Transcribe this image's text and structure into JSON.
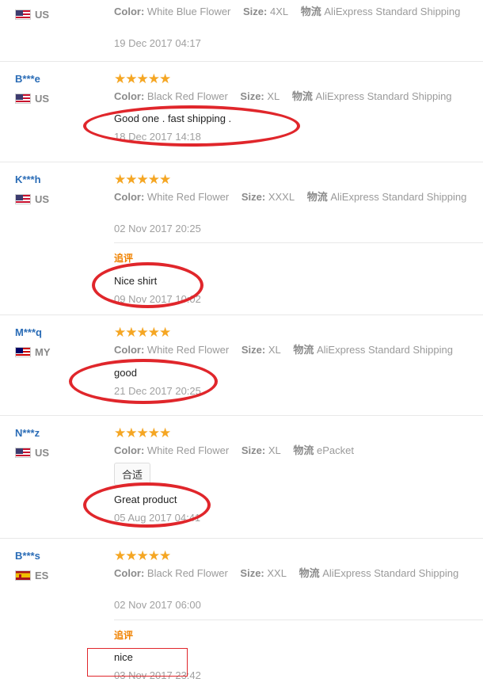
{
  "labels": {
    "color": "Color:",
    "size": "Size:",
    "shipping": "物流",
    "followup": "追评",
    "stars": "★★★★★"
  },
  "reviews": [
    {
      "name": "",
      "country": "US",
      "color": "White Blue Flower",
      "size": "4XL",
      "shipping": "AliExpress Standard Shipping",
      "date": "19 Dec 2017 04:17"
    },
    {
      "name": "B***e",
      "country": "US",
      "color": "Black Red Flower",
      "size": "XL",
      "shipping": "AliExpress Standard Shipping",
      "text": "Good one . fast shipping .",
      "date": "18 Dec 2017 14:18"
    },
    {
      "name": "K***h",
      "country": "US",
      "color": "White Red Flower",
      "size": "XXXL",
      "shipping": "AliExpress Standard Shipping",
      "date": "02 Nov 2017 20:25",
      "followup_text": "Nice shirt",
      "followup_date": "09 Nov 2017 10:02"
    },
    {
      "name": "M***q",
      "country": "MY",
      "color": "White Red Flower",
      "size": "XL",
      "shipping": "AliExpress Standard Shipping",
      "text": "good",
      "date": "21 Dec 2017 20:25"
    },
    {
      "name": "N***z",
      "country": "US",
      "color": "White Red Flower",
      "size": "XL",
      "shipping": "ePacket",
      "tag": "合适",
      "text": "Great product",
      "date": "05 Aug 2017 04:41"
    },
    {
      "name": "B***s",
      "country": "ES",
      "color": "Black Red Flower",
      "size": "XXL",
      "shipping": "AliExpress Standard Shipping",
      "date": "02 Nov 2017 06:00",
      "followup_text": "nice",
      "followup_date": "03 Nov 2017 23:42"
    }
  ],
  "colors": {
    "accent_name": "#2a6cb6",
    "stars": "#f5a623",
    "followup": "#f08200",
    "annotation": "#e0262b"
  },
  "ratings": [
    5,
    5,
    5,
    5,
    5,
    5
  ]
}
